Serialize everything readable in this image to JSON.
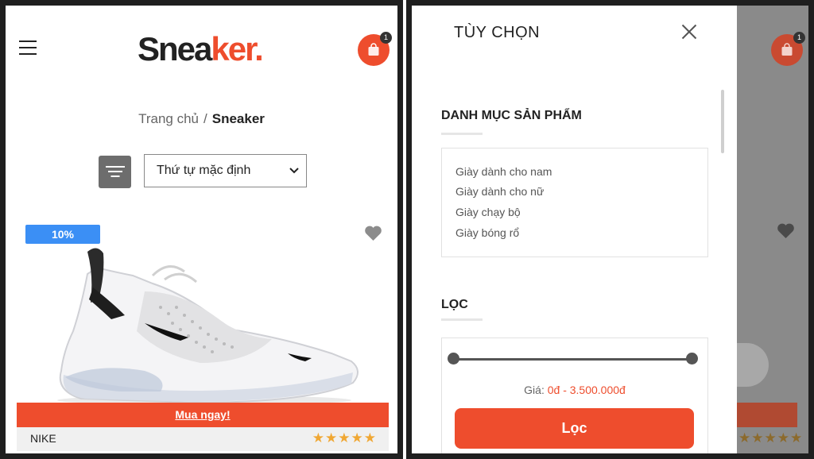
{
  "shop": {
    "logo_main": "Snea",
    "logo_accent": "ker.",
    "cart_count": "1",
    "breadcrumb_home": "Trang chủ",
    "breadcrumb_sep": "/",
    "breadcrumb_current": "Sneaker",
    "sort_selected": "Thứ tự mặc định",
    "product": {
      "discount": "10%",
      "buy_label": "Mua ngay!",
      "brand": "NIKE",
      "rating": 5,
      "stars": "★★★★★"
    }
  },
  "filter_panel": {
    "title": "TÙY CHỌN",
    "category_heading": "DANH MỤC SẢN PHẨM",
    "categories": [
      "Giày dành cho nam",
      "Giày dành cho nữ",
      "Giày chạy bộ",
      "Giày bóng rổ"
    ],
    "filter_heading": "LỌC",
    "price_label": "Giá:",
    "price_range": "0đ - 3.500.000đ",
    "price_min": 0,
    "price_max": 3500000,
    "slider_low": 0,
    "slider_high": 1,
    "filter_button": "Lọc"
  },
  "icons": {
    "menu": "hamburger-icon",
    "cart": "shopping-bag-icon",
    "filter": "filter-icon",
    "favorite": "heart-icon",
    "close": "close-icon"
  },
  "colors": {
    "accent": "#ee4d2d",
    "discount_badge": "#3b8ff5",
    "stars": "#f0a733",
    "filter_button_bg": "#6d6d6d"
  }
}
